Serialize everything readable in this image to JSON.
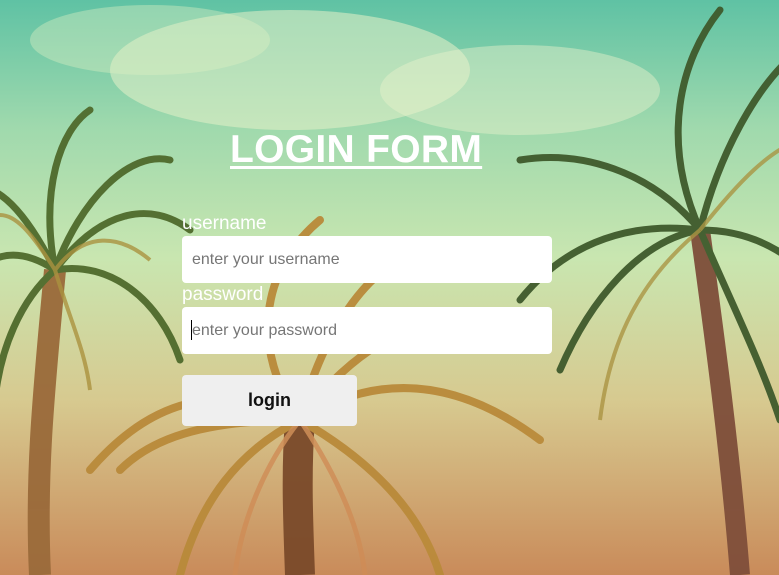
{
  "form": {
    "title": "LOGIN FORM",
    "username_label": "username",
    "username_placeholder": "enter your username",
    "password_label": "password",
    "password_placeholder": "enter your password",
    "submit_label": "login"
  },
  "colors": {
    "sky_top": "#5fc2a4",
    "sky_mid": "#c9e6b0",
    "ground_warm": "#c98b5a",
    "palm_dark": "#3d5a2a",
    "palm_gold": "#b99a3c",
    "text": "#ffffff",
    "button_bg": "#efefef"
  }
}
